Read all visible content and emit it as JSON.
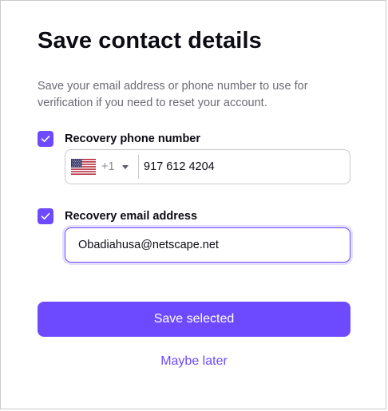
{
  "dialog": {
    "title": "Save contact details",
    "description": "Save your email address or phone number to use for verification if you need to reset your account."
  },
  "phone": {
    "checked": true,
    "label": "Recovery phone number",
    "country_flag": "us-flag-icon",
    "dial_code": "+1",
    "value": "917 612 4204"
  },
  "email": {
    "checked": true,
    "label": "Recovery email address",
    "value": "Obadiahusa@netscape.net"
  },
  "actions": {
    "save_label": "Save selected",
    "later_label": "Maybe later"
  },
  "colors": {
    "accent": "#6d4aff",
    "text": "#0c0c14",
    "muted": "#6b6b75",
    "border": "#c9c9cf"
  }
}
